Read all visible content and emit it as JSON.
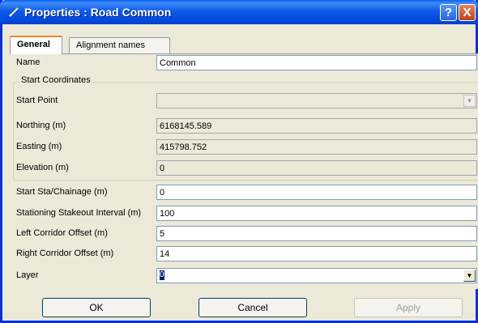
{
  "window": {
    "title": "Properties : Road Common",
    "help_glyph": "?",
    "close_glyph": "X"
  },
  "tabs": [
    {
      "label": "General",
      "active": true
    },
    {
      "label": "Alignment names",
      "active": false
    }
  ],
  "fields": {
    "name": {
      "label": "Name",
      "value": "Common"
    },
    "start_coordinates_group": "Start Coordinates",
    "start_point": {
      "label": "Start Point",
      "value": ""
    },
    "northing": {
      "label": "Northing (m)",
      "value": "6168145.589"
    },
    "easting": {
      "label": "Easting (m)",
      "value": "415798.752"
    },
    "elevation": {
      "label": "Elevation (m)",
      "value": "0"
    },
    "start_sta": {
      "label": "Start Sta/Chainage (m)",
      "value": "0"
    },
    "stakeout_interval": {
      "label": "Stationing Stakeout Interval (m)",
      "value": "100"
    },
    "left_offset": {
      "label": "Left Corridor Offset (m)",
      "value": "5"
    },
    "right_offset": {
      "label": "Right Corridor Offset (m)",
      "value": "14"
    },
    "layer": {
      "label": "Layer",
      "value": "0"
    }
  },
  "buttons": {
    "ok": "OK",
    "cancel": "Cancel",
    "apply": "Apply"
  },
  "colors": {
    "titlebar": "#0a5ff1",
    "dialog_bg": "#ece9d8",
    "tab_highlight": "#e68b2c"
  },
  "icons": {
    "title": "pencil-icon",
    "dropdown": "chevron-down-icon"
  }
}
